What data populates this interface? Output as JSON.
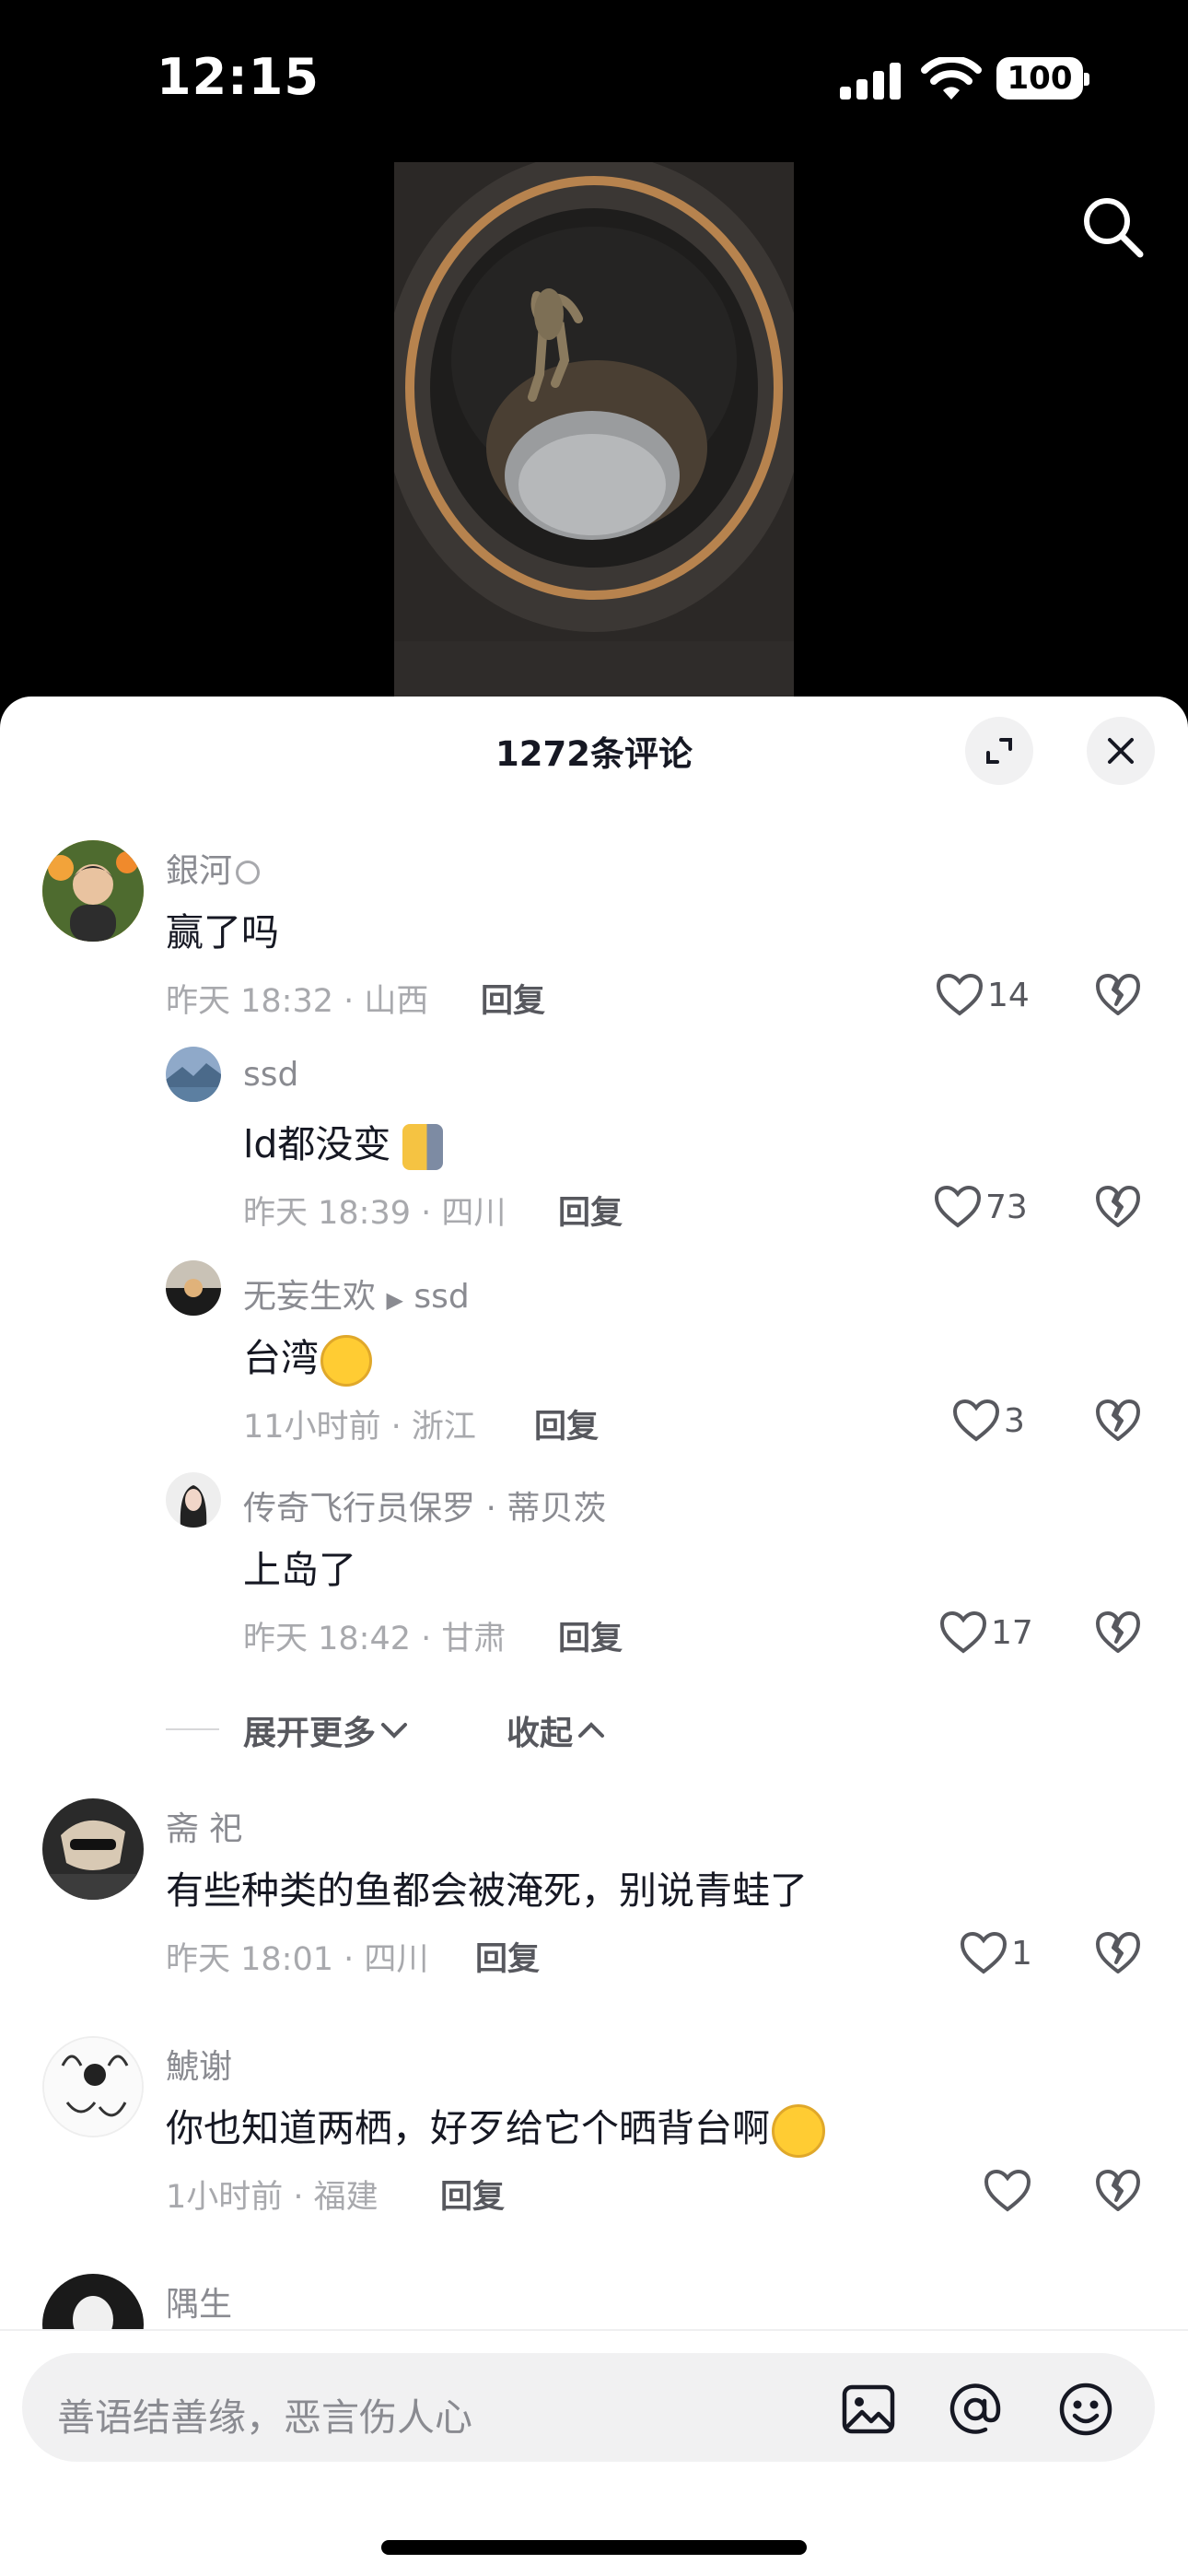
{
  "status_bar": {
    "time": "12:15",
    "battery": "100"
  },
  "sheet": {
    "title": "1272条评论"
  },
  "comments": [
    {
      "user": "銀河",
      "text": "赢了吗",
      "meta": "昨天 18:32 · 山西",
      "reply": "回复",
      "likes": "14"
    },
    {
      "user": "ssd",
      "text": "ld都没变",
      "meta": "昨天 18:39 · 四川",
      "reply": "回复",
      "likes": "73"
    },
    {
      "user": "无妄生欢",
      "reply_to": "ssd",
      "text": "台湾",
      "meta": "11小时前 · 浙江",
      "reply": "回复",
      "likes": "3"
    },
    {
      "user": "传奇飞行员保罗 · 蒂贝茨",
      "text": "上岛了",
      "meta": "昨天 18:42 · 甘肃",
      "reply": "回复",
      "likes": "17"
    },
    {
      "user": "斋 祀",
      "text": "有些种类的鱼都会被淹死，别说青蛙了",
      "meta": "昨天 18:01 · 四川",
      "reply": "回复",
      "likes": "1"
    },
    {
      "user": "鯱谢",
      "text": "你也知道两栖，好歹给它个晒背台啊",
      "meta": "1小时前 · 福建",
      "reply": "回复",
      "likes": ""
    },
    {
      "user": "隅生"
    }
  ],
  "thread_controls": {
    "expand": "展开更多",
    "collapse": "收起"
  },
  "input": {
    "placeholder": "善语结善缘，恶言伤人心"
  },
  "colors": {
    "sheet_bg": "#ffffff",
    "text_primary": "#161823",
    "text_secondary": "#8a8b91"
  }
}
